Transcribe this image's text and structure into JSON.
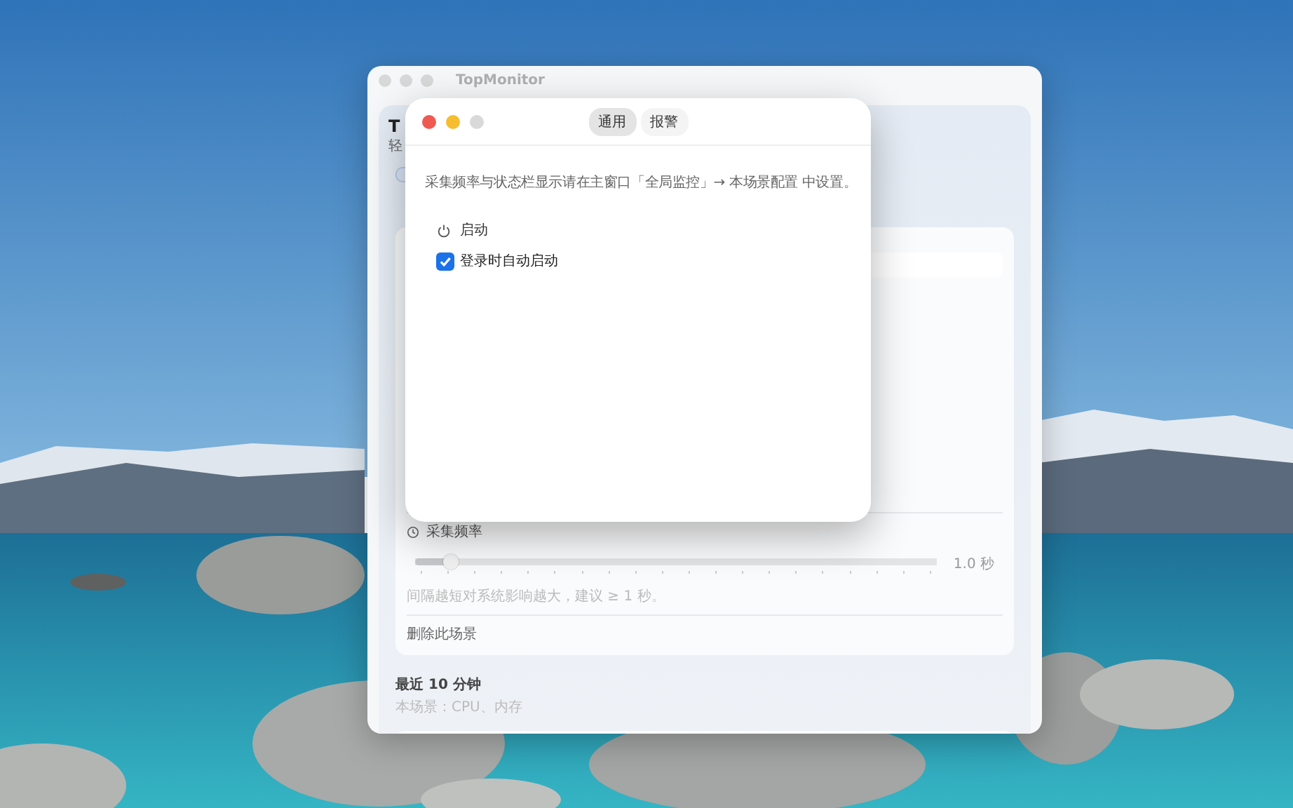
{
  "main_window": {
    "title": "TopMonitor",
    "heading": "T",
    "subtitle": "轻",
    "scene_card": {
      "slider": {
        "label": "采集频率",
        "level": 0.07,
        "reading": "1.0 秒"
      },
      "hint": "间隔越短对系统影响越大，建议 ≥ 1 秒。",
      "delete_label": "删除此场景"
    },
    "recent": {
      "title": "最近 10 分钟",
      "subtitle": "本场景：CPU、内存"
    }
  },
  "settings_dialog": {
    "tabs": [
      {
        "label": "通用",
        "selected": true
      },
      {
        "label": "报警",
        "selected": false
      }
    ],
    "note": "采集频率与状态栏显示请在主窗口「全局监控」→ 本场景配置 中设置。",
    "section": "启动",
    "options": [
      {
        "label": "登录时自动启动",
        "checked": true
      }
    ]
  }
}
